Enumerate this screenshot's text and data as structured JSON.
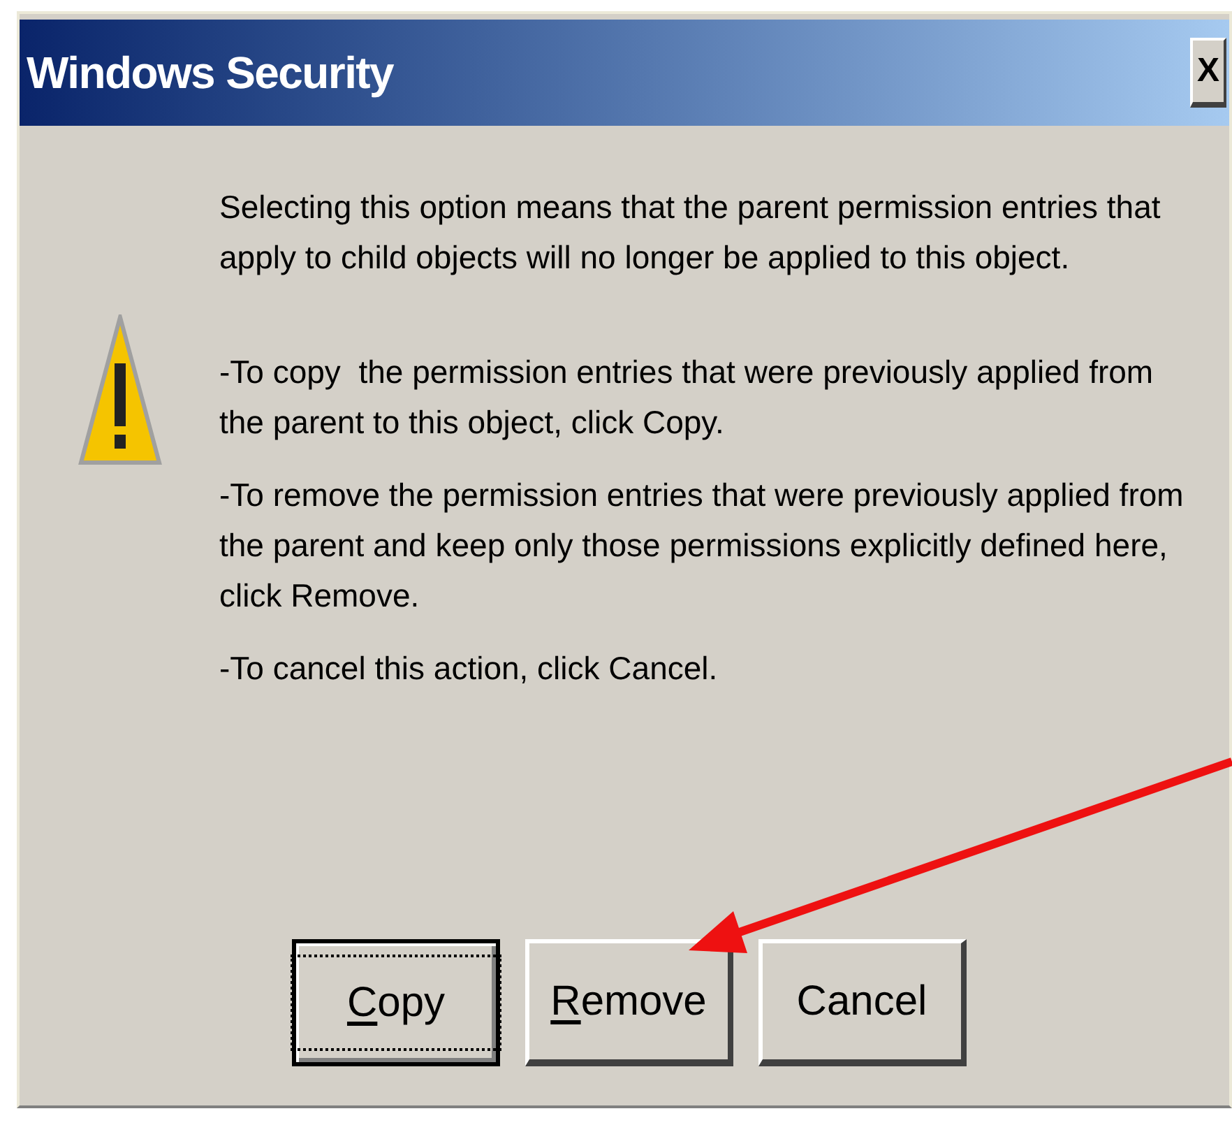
{
  "window": {
    "title": "Windows Security",
    "close_label": "X"
  },
  "message": [
    "Selecting this option means that the parent permission entries that apply to child objects will no longer be applied to this object.",
    "-To copy  the permission entries that were previously applied from the parent to this object, click Copy.",
    "-To remove the permission entries that were previously applied from the parent and keep only those permissions explicitly defined here, click Remove.",
    "-To cancel this action, click Cancel."
  ],
  "buttons": [
    {
      "label": "Copy",
      "mnemonic": true,
      "default": true
    },
    {
      "label": "Remove",
      "mnemonic": true,
      "default": false
    },
    {
      "label": "Cancel",
      "mnemonic": false,
      "default": false
    }
  ]
}
